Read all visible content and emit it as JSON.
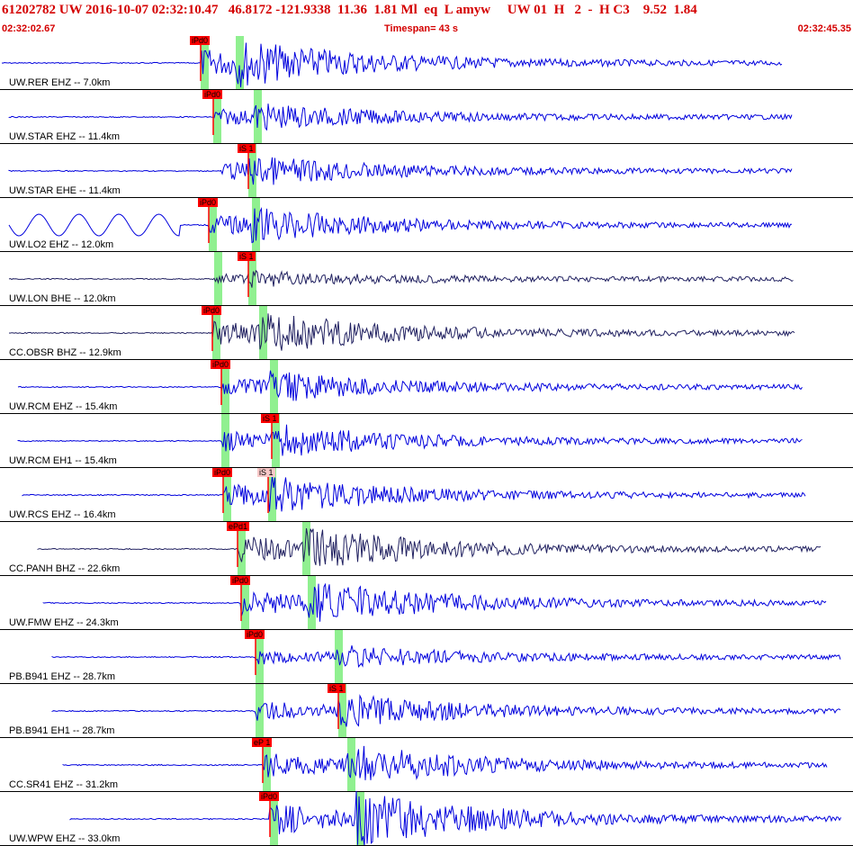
{
  "header": {
    "title": "61202782 UW 2016-10-07 02:32:10.47   46.8172 -121.9338  11.36  1.81 Ml  eq  L amyw     UW 01  H   2  -  H C3    9.52  1.84",
    "start_time": "02:32:02.67",
    "timespan": "Timespan=  43 s",
    "end_time": "02:32:45.35"
  },
  "colors": {
    "title": "#d40000",
    "trace": "#0000dd",
    "trace_dark": "#202060",
    "pick_green": "#90f090",
    "pick_line": "#ff0000",
    "pick_tag": "#ff0000",
    "pick_tag_pale": "#f8c8c8",
    "separator": "#000000"
  },
  "traces": [
    {
      "label": "UW.RER EHZ -- 7.0km",
      "picks": [
        {
          "tag": "iPd0"
        }
      ]
    },
    {
      "label": "UW.STAR EHZ -- 11.4km",
      "picks": [
        {
          "tag": "iPd0"
        }
      ]
    },
    {
      "label": "UW.STAR EHE -- 11.4km",
      "picks": [
        {
          "tag": "iS 1"
        }
      ]
    },
    {
      "label": "UW.LO2 EHZ -- 12.0km",
      "picks": [
        {
          "tag": "iPd0"
        }
      ]
    },
    {
      "label": "UW.LON BHE -- 12.0km",
      "picks": [
        {
          "tag": "iS 1"
        }
      ]
    },
    {
      "label": "CC.OBSR BHZ -- 12.9km",
      "picks": [
        {
          "tag": "iPd0"
        }
      ]
    },
    {
      "label": "UW.RCM EHZ -- 15.4km",
      "picks": [
        {
          "tag": "iPd0"
        }
      ]
    },
    {
      "label": "UW.RCM EH1 -- 15.4km",
      "picks": [
        {
          "tag": "iS 1"
        }
      ]
    },
    {
      "label": "UW.RCS EHZ -- 16.4km",
      "picks": [
        {
          "tag": "iPd0"
        },
        {
          "tag": "iS 1"
        }
      ]
    },
    {
      "label": "CC.PANH BHZ -- 22.6km",
      "picks": [
        {
          "tag": "ePd1"
        }
      ]
    },
    {
      "label": "UW.FMW EHZ -- 24.3km",
      "picks": [
        {
          "tag": "iPd0"
        }
      ]
    },
    {
      "label": "PB.B941 EHZ -- 28.7km",
      "picks": [
        {
          "tag": "iPd0"
        }
      ]
    },
    {
      "label": "PB.B941 EH1 -- 28.7km",
      "picks": [
        {
          "tag": "iS 1"
        }
      ]
    },
    {
      "label": "CC.SR41 EHZ -- 31.2km",
      "picks": [
        {
          "tag": "eP 1"
        }
      ]
    },
    {
      "label": "UW.WPW EHZ -- 33.0km",
      "picks": [
        {
          "tag": "iPd0"
        }
      ]
    }
  ]
}
